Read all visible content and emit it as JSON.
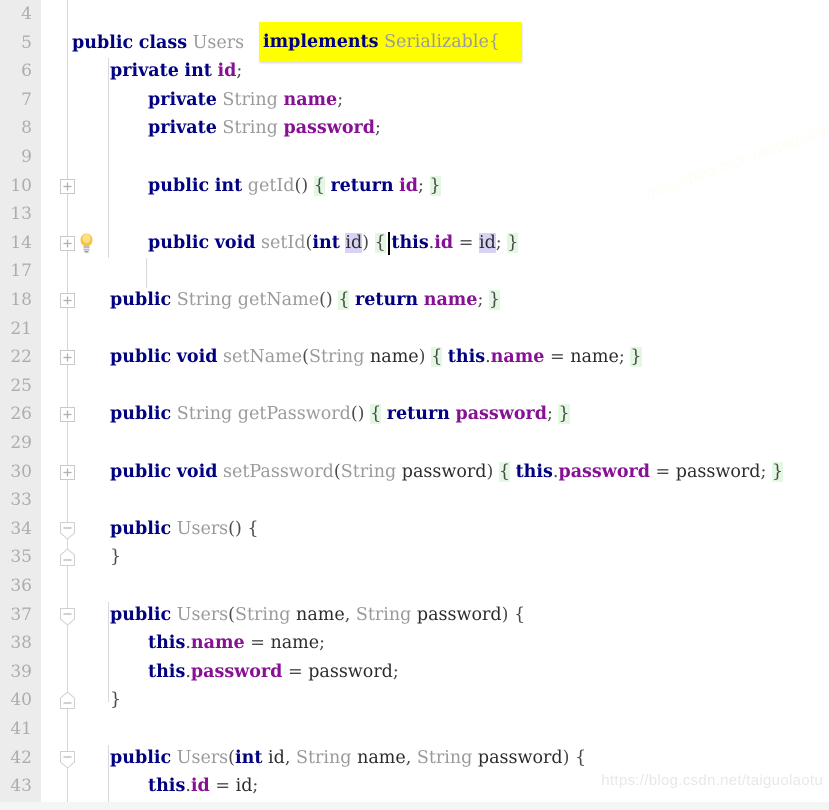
{
  "editor": {
    "app": "IntelliJ IDEA Java Editor",
    "file_class": "Users",
    "caret_line": 24,
    "colors": {
      "gutter_bg": "#ececec",
      "editor_bg": "#ffffff",
      "current_line_bg": "#fffbe6",
      "keyword": "#000080",
      "field": "#871094",
      "type_grey": "#9a9a9a",
      "brace_match_bg": "#e3f7e3",
      "identifier_bg": "#d8d2f5",
      "search_highlight_bg": "#ffff00",
      "lineno": "#adadad"
    },
    "search_highlight": {
      "text": "implements Serializable{",
      "keyword": "implements",
      "rest": " Serializable{"
    },
    "watermark": "https://blog.csdn.net/taiguolaotu",
    "lines": [
      {
        "no": "4",
        "indent": 0,
        "code": ""
      },
      {
        "no": "5",
        "indent": 0,
        "code": "public class Users implements Serializable{"
      },
      {
        "no": "6",
        "indent": 1,
        "code": "private int id;"
      },
      {
        "no": "7",
        "indent": 2,
        "code": "private String name;"
      },
      {
        "no": "8",
        "indent": 2,
        "code": "private String password;"
      },
      {
        "no": "9",
        "indent": 0,
        "code": ""
      },
      {
        "no": "10",
        "indent": 2,
        "code": "public int getId() { return id; }"
      },
      {
        "no": "13",
        "indent": 0,
        "code": ""
      },
      {
        "no": "14",
        "indent": 2,
        "code": "public void setId(int id) { this.id = id; }"
      },
      {
        "no": "17",
        "indent": 0,
        "code": ""
      },
      {
        "no": "18",
        "indent": 1,
        "code": "public String getName() { return name; }"
      },
      {
        "no": "21",
        "indent": 0,
        "code": ""
      },
      {
        "no": "22",
        "indent": 1,
        "code": "public void setName(String name) { this.name = name; }"
      },
      {
        "no": "25",
        "indent": 0,
        "code": ""
      },
      {
        "no": "26",
        "indent": 1,
        "code": "public String getPassword() { return password; }"
      },
      {
        "no": "29",
        "indent": 0,
        "code": ""
      },
      {
        "no": "30",
        "indent": 1,
        "code": "public void setPassword(String password) { this.password = password; }"
      },
      {
        "no": "33",
        "indent": 0,
        "code": ""
      },
      {
        "no": "34",
        "indent": 1,
        "code": "public Users() {"
      },
      {
        "no": "35",
        "indent": 1,
        "code": "}"
      },
      {
        "no": "36",
        "indent": 0,
        "code": ""
      },
      {
        "no": "37",
        "indent": 1,
        "code": "public Users(String name, String password) {"
      },
      {
        "no": "38",
        "indent": 2,
        "code": "this.name = name;"
      },
      {
        "no": "39",
        "indent": 2,
        "code": "this.password = password;"
      },
      {
        "no": "40",
        "indent": 1,
        "code": "}"
      },
      {
        "no": "41",
        "indent": 0,
        "code": ""
      },
      {
        "no": "42",
        "indent": 1,
        "code": "public Users(int id, String name, String password) {"
      },
      {
        "no": "43",
        "indent": 2,
        "code": "this.id = id;"
      }
    ],
    "fold_markers": [
      {
        "line": "10",
        "type": "plus"
      },
      {
        "line": "14",
        "type": "plus"
      },
      {
        "line": "18",
        "type": "plus"
      },
      {
        "line": "22",
        "type": "plus"
      },
      {
        "line": "26",
        "type": "plus"
      },
      {
        "line": "30",
        "type": "plus"
      },
      {
        "line": "34",
        "type": "minus-start"
      },
      {
        "line": "35",
        "type": "minus-end"
      },
      {
        "line": "37",
        "type": "minus-start"
      },
      {
        "line": "40",
        "type": "minus-end"
      },
      {
        "line": "42",
        "type": "minus-start"
      }
    ],
    "intention_bulb": {
      "line": "14",
      "icon": "lightbulb-icon"
    }
  }
}
